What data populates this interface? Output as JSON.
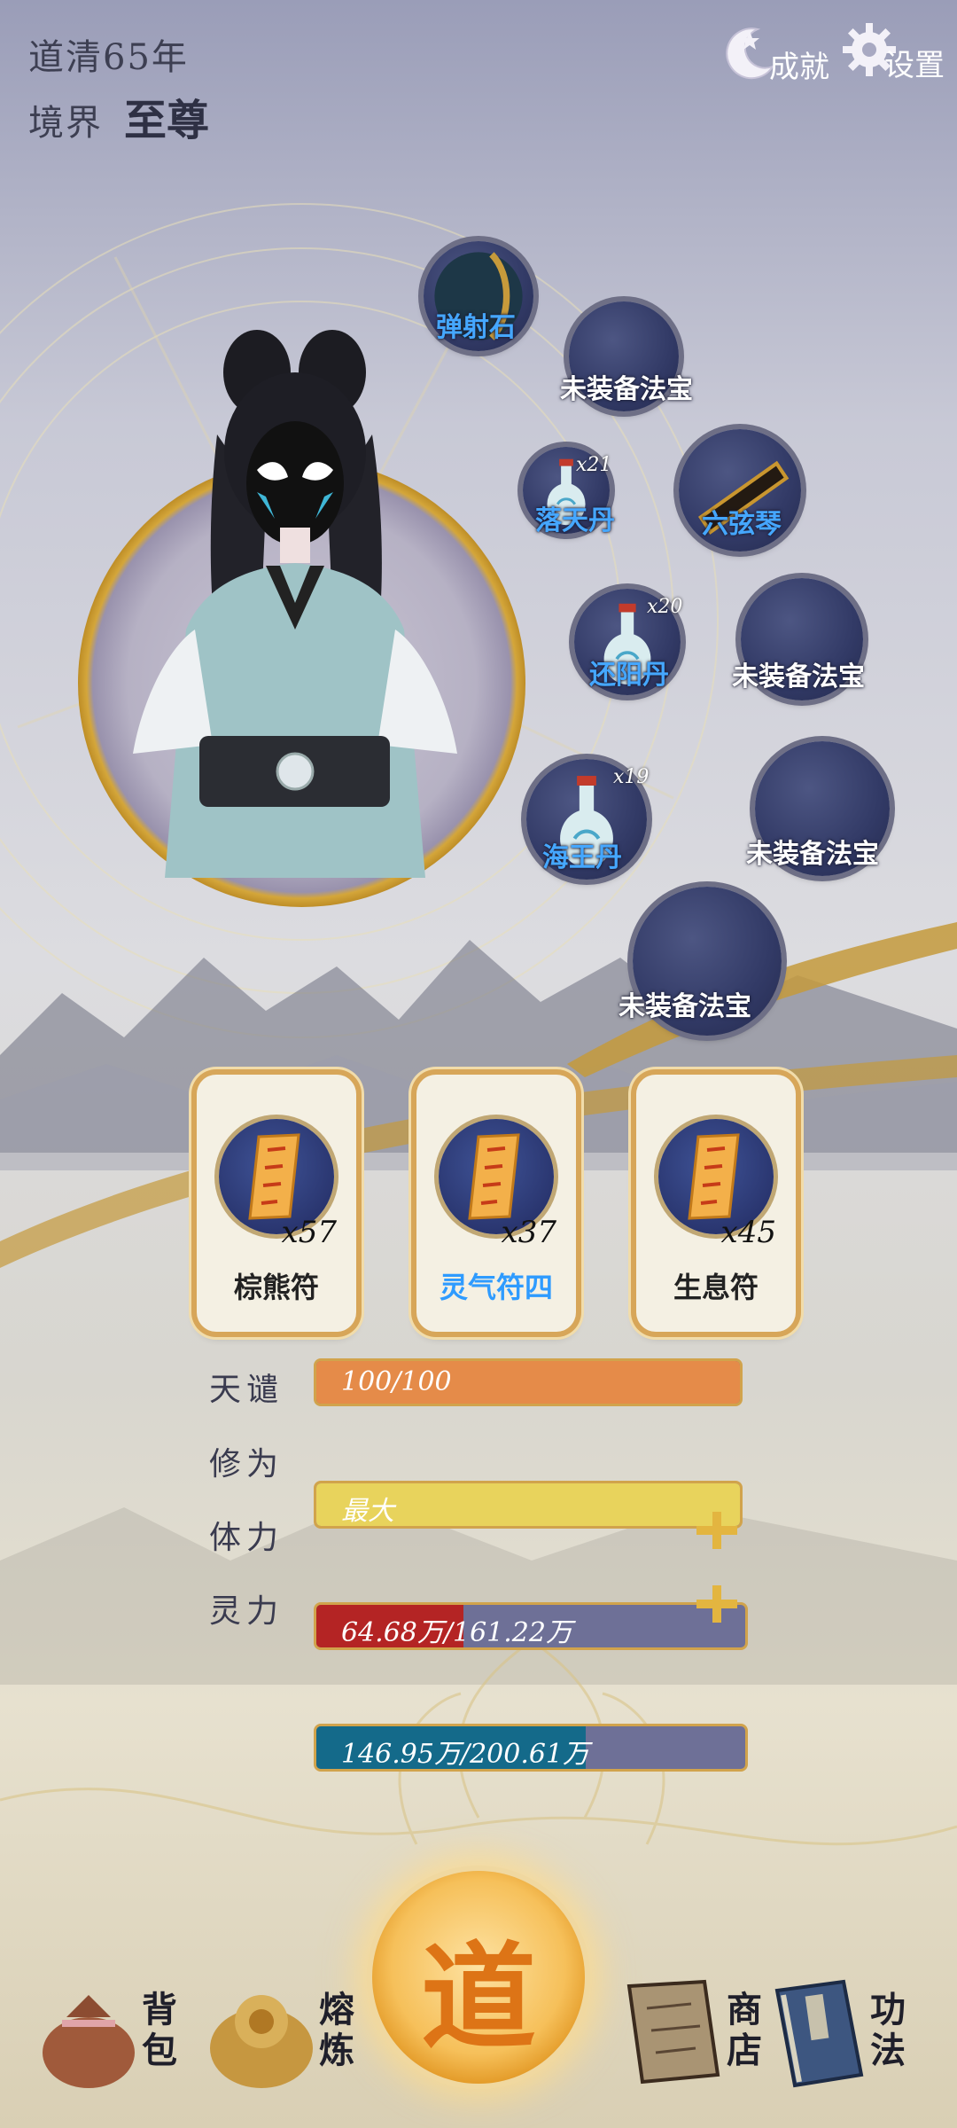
{
  "hud": {
    "year": "道清65年",
    "realm_label": "境界",
    "realm_value": "至尊"
  },
  "top_buttons": {
    "achievements": "成就",
    "settings": "设置"
  },
  "slots": [
    {
      "label": "弹射石",
      "count": "",
      "style": "blue",
      "type": "stone"
    },
    {
      "label": "未装备法宝",
      "count": "",
      "style": "white",
      "type": "empty"
    },
    {
      "label": "落天丹",
      "count": "x21",
      "style": "blue",
      "type": "vase"
    },
    {
      "label": "六弦琴",
      "count": "",
      "style": "blue",
      "type": "qin"
    },
    {
      "label": "还阳丹",
      "count": "x20",
      "style": "blue",
      "type": "vase"
    },
    {
      "label": "未装备法宝",
      "count": "",
      "style": "white",
      "type": "empty"
    },
    {
      "label": "海王丹",
      "count": "x19",
      "style": "blue",
      "type": "vase"
    },
    {
      "label": "未装备法宝",
      "count": "",
      "style": "white",
      "type": "empty"
    },
    {
      "label": "未装备法宝",
      "count": "",
      "style": "white",
      "type": "empty"
    }
  ],
  "talismans": [
    {
      "name": "棕熊符",
      "count": "x57",
      "style": "dark"
    },
    {
      "name": "灵气符四",
      "count": "x37",
      "style": "blue"
    },
    {
      "name": "生息符",
      "count": "x45",
      "style": "dark"
    }
  ],
  "stats": [
    {
      "label": "天谴",
      "value": "100/100",
      "fill": 1.0,
      "color": "#e58b49",
      "plus": false
    },
    {
      "label": "修为",
      "value": "最大",
      "fill": 1.0,
      "color": "#e8d35c",
      "plus": false
    },
    {
      "label": "体力",
      "value": "64.68万/161.22万",
      "fill": 0.4,
      "color": "#b42424",
      "plus": true
    },
    {
      "label": "灵力",
      "value": "146.95万/200.61万",
      "fill": 0.73,
      "color": "#146a8a",
      "plus": true
    }
  ],
  "center_button": {
    "glyph": "道"
  },
  "bottom_nav": {
    "bag": "背包",
    "smelt": "熔炼",
    "shop": "商店",
    "skills": "功法"
  },
  "colors": {
    "gold": "#d4a63a",
    "slot_blue": "#323a66",
    "accent_blue": "#45a7ff"
  }
}
